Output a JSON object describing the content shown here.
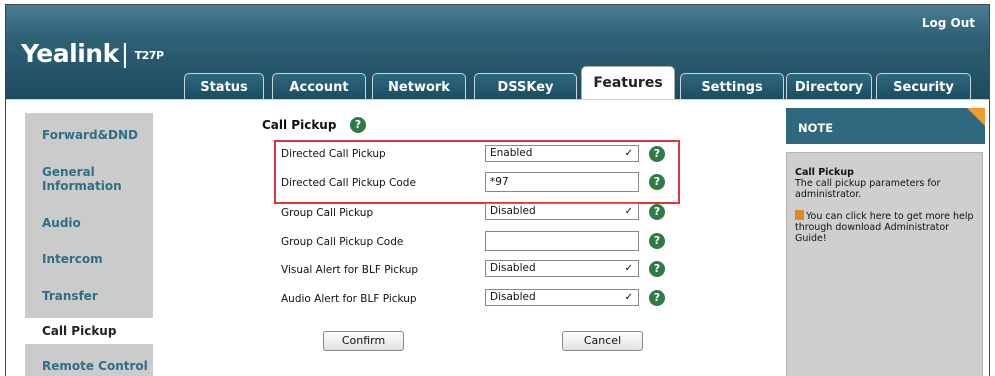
{
  "header": {
    "brand": "Yealink",
    "model": "T27P",
    "logout_label": "Log Out"
  },
  "tabs": [
    {
      "label": "Status"
    },
    {
      "label": "Account"
    },
    {
      "label": "Network"
    },
    {
      "label": "DSSKey"
    },
    {
      "label": "Features",
      "active": true
    },
    {
      "label": "Settings"
    },
    {
      "label": "Directory"
    },
    {
      "label": "Security"
    }
  ],
  "sidebar": {
    "items": [
      {
        "label": "Forward&DND"
      },
      {
        "label": "General Information"
      },
      {
        "label": "Audio"
      },
      {
        "label": "Intercom"
      },
      {
        "label": "Transfer"
      },
      {
        "label": "Call Pickup",
        "active": true
      },
      {
        "label": "Remote Control"
      }
    ]
  },
  "main": {
    "title": "Call Pickup",
    "rows": [
      {
        "label": "Directed Call Pickup",
        "type": "select",
        "value": "Enabled"
      },
      {
        "label": "Directed Call Pickup Code",
        "type": "input",
        "value": "*97"
      },
      {
        "label": "Group Call Pickup",
        "type": "select",
        "value": "Disabled"
      },
      {
        "label": "Group Call Pickup Code",
        "type": "input",
        "value": ""
      },
      {
        "label": "Visual Alert for BLF Pickup",
        "type": "select",
        "value": "Disabled"
      },
      {
        "label": "Audio Alert for BLF Pickup",
        "type": "select",
        "value": "Disabled"
      }
    ],
    "confirm_label": "Confirm",
    "cancel_label": "Cancel",
    "help_glyph": "?"
  },
  "note": {
    "heading": "NOTE",
    "title": "Call Pickup",
    "desc": "The call pickup parameters for administrator.",
    "help_text": "You can click here to get more help through download Administrator Guide!"
  },
  "colors": {
    "header": "#2f6176",
    "accent_orange": "#f39a2e",
    "highlight_red": "#e0343a",
    "help_green": "#2f7a45",
    "sidebar_text": "#2e6f86"
  }
}
